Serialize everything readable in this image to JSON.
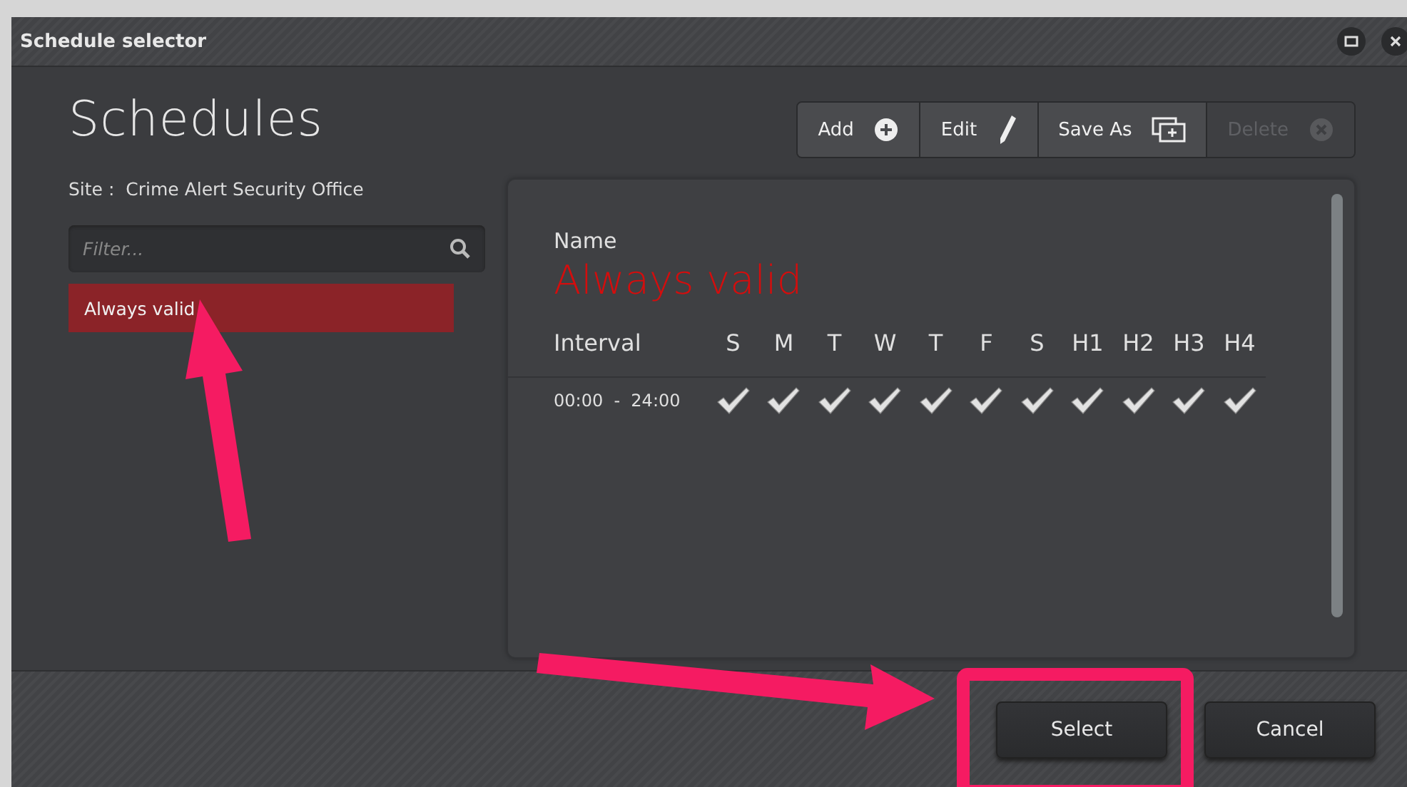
{
  "window": {
    "title": "Schedule selector"
  },
  "heading": "Schedules",
  "toolbar": [
    {
      "label": "Add",
      "kind": "add",
      "disabled": false
    },
    {
      "label": "Edit",
      "kind": "edit",
      "disabled": false
    },
    {
      "label": "Save As",
      "kind": "save-as",
      "disabled": false
    },
    {
      "label": "Delete",
      "kind": "delete",
      "disabled": true
    }
  ],
  "site": {
    "label": "Site :",
    "value": "Crime Alert Security Office"
  },
  "filter": {
    "placeholder": "Filter..."
  },
  "schedules": [
    {
      "label": "Always valid",
      "selected": true
    }
  ],
  "detail": {
    "name_label": "Name",
    "name": "Always valid",
    "interval_label": "Interval",
    "days": [
      {
        "label": "S"
      },
      {
        "label": "M"
      },
      {
        "label": "T"
      },
      {
        "label": "W"
      },
      {
        "label": "T"
      },
      {
        "label": "F"
      },
      {
        "label": "S"
      },
      {
        "label": "H1"
      },
      {
        "label": "H2"
      },
      {
        "label": "H3"
      },
      {
        "label": "H4"
      }
    ],
    "rows": [
      {
        "interval": "00:00  -  24:00",
        "checks": [
          true,
          true,
          true,
          true,
          true,
          true,
          true,
          true,
          true,
          true,
          true
        ]
      }
    ]
  },
  "buttons": [
    {
      "label": "Select"
    },
    {
      "label": "Cancel"
    }
  ]
}
